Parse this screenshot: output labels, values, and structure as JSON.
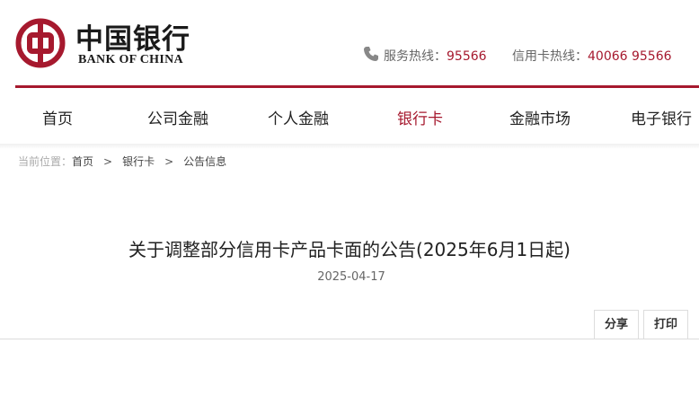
{
  "brand": {
    "name_cn": "中国银行",
    "name_en": "BANK OF CHINA",
    "color": "#a6192e"
  },
  "hotlines": {
    "service_label": "服务热线：",
    "service_number": "95566",
    "card_label": "信用卡热线：",
    "card_number": "40066 95566",
    "icon": "phone-icon"
  },
  "nav": {
    "items": [
      {
        "label": "首页"
      },
      {
        "label": "公司金融"
      },
      {
        "label": "个人金融"
      },
      {
        "label": "银行卡",
        "active": true
      },
      {
        "label": "金融市场"
      },
      {
        "label": "电子银行"
      }
    ]
  },
  "breadcrumb": {
    "prefix": "当前位置：",
    "items": [
      "首页",
      "银行卡",
      "公告信息"
    ],
    "separator": ">"
  },
  "article": {
    "title": "关于调整部分信用卡产品卡面的公告(2025年6月1日起)",
    "date": "2025-04-17"
  },
  "actions": {
    "share_label": "分享",
    "print_label": "打印"
  }
}
